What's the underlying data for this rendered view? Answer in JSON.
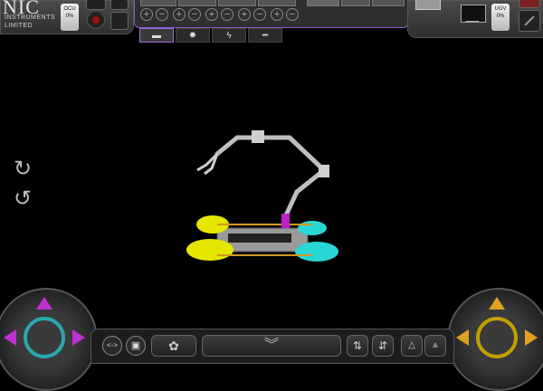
{
  "logo": {
    "mark": "NIC",
    "line1": "INSTRUMENTS",
    "line2": "LIMITED"
  },
  "ocu": {
    "label": "OCU",
    "value": "0%"
  },
  "ugv": {
    "label": "UGV",
    "value": "0%"
  },
  "toolbar": {
    "plus_minus": [
      "+",
      "−",
      "+",
      "−",
      "+",
      "−",
      "+",
      "−",
      "+",
      "−"
    ]
  },
  "tabs": [
    {
      "icon": "camera-icon",
      "glyph": "▬"
    },
    {
      "icon": "light-icon",
      "glyph": "✹"
    },
    {
      "icon": "lightning-icon",
      "glyph": "ϟ"
    },
    {
      "icon": "tool-icon",
      "glyph": "━"
    }
  ],
  "bottom_bar": {
    "btn_code": "<->",
    "btn_cap": "▣",
    "btn_gear": "✿",
    "btn_expand": "︾",
    "btn_a": "⇅",
    "btn_b": "⇵",
    "btn_c": "△",
    "btn_d": "⩓"
  },
  "colors": {
    "left_joystick": "#c030d0",
    "left_ring": "#2aa6b0",
    "right_joystick": "#e0a020",
    "right_ring": "#c0a000",
    "robot_body": "#bfbfbf",
    "track_yellow": "#e6e600",
    "track_cyan": "#29d6d6",
    "accent_purple": "#8a5ad0"
  }
}
